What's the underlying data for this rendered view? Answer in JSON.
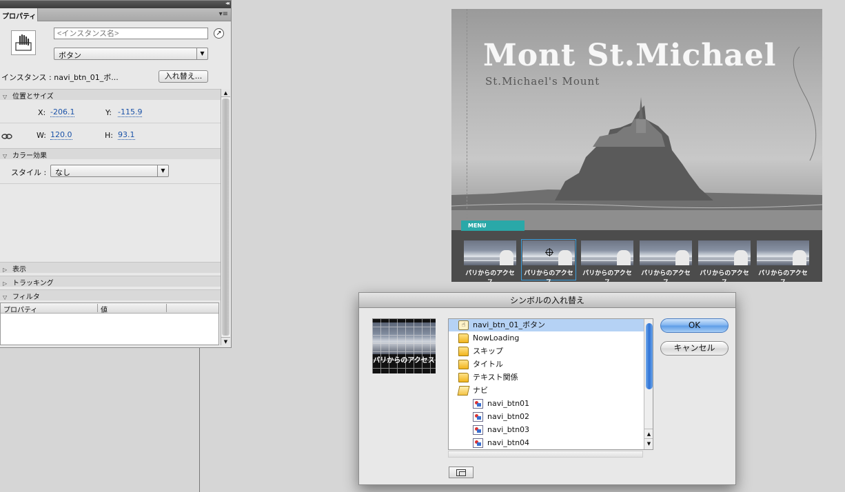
{
  "properties_panel": {
    "tab_label": "プロパティ",
    "menu_icon": "▾≡",
    "collapse_icon": "◂◂",
    "instance_name_placeholder": "<インスタンス名>",
    "symbol_type": "ボタン",
    "instance_label": "インスタンス : navi_btn_01_ボ...",
    "swap_button": "入れ替え...",
    "section_position_size": "位置とサイズ",
    "x_label": "X:",
    "x_value": "-206.1",
    "y_label": "Y:",
    "y_value": "-115.9",
    "w_label": "W:",
    "w_value": "120.0",
    "h_label": "H:",
    "h_value": "93.1",
    "section_color_effect": "カラー効果",
    "style_label": "スタイル :",
    "style_value": "なし",
    "section_display": "表示",
    "section_tracking": "トラッキング",
    "section_filter": "フィルタ",
    "filter_col_property": "プロパティ",
    "filter_col_value": "値"
  },
  "stage": {
    "title": "Mont St.Michael",
    "subtitle": "St.Michael's Mount",
    "menu_tab": "MENU",
    "nav_buttons": [
      "パリからのアクセス",
      "パリからのアクセス",
      "パリからのアクセス",
      "パリからのアクセス",
      "パリからのアクセス",
      "パリからのアクセス"
    ],
    "selected_nav_index": 1
  },
  "dialog": {
    "title": "シンボルの入れ替え",
    "preview_caption": "パリからのアクセス",
    "ok": "OK",
    "cancel": "キャンセル",
    "items": [
      {
        "label": "navi_btn_01_ボタン",
        "icon": "button-symbol-icon",
        "selected": true,
        "indent": false
      },
      {
        "label": "NowLoading",
        "icon": "folder-icon",
        "selected": false,
        "indent": false
      },
      {
        "label": "スキップ",
        "icon": "folder-icon",
        "selected": false,
        "indent": false
      },
      {
        "label": "タイトル",
        "icon": "folder-icon",
        "selected": false,
        "indent": false
      },
      {
        "label": "テキスト関係",
        "icon": "folder-icon",
        "selected": false,
        "indent": false
      },
      {
        "label": "ナビ",
        "icon": "folder-open-icon",
        "selected": false,
        "indent": false
      },
      {
        "label": "navi_btn01",
        "icon": "graphic-symbol-icon",
        "selected": false,
        "indent": true
      },
      {
        "label": "navi_btn02",
        "icon": "graphic-symbol-icon",
        "selected": false,
        "indent": true
      },
      {
        "label": "navi_btn03",
        "icon": "graphic-symbol-icon",
        "selected": false,
        "indent": true
      },
      {
        "label": "navi_btn04",
        "icon": "graphic-symbol-icon",
        "selected": false,
        "indent": true
      }
    ]
  },
  "colors": {
    "accent": "#2aa8a8",
    "selection": "#b5d2f5",
    "link_value": "#1a52a8"
  }
}
